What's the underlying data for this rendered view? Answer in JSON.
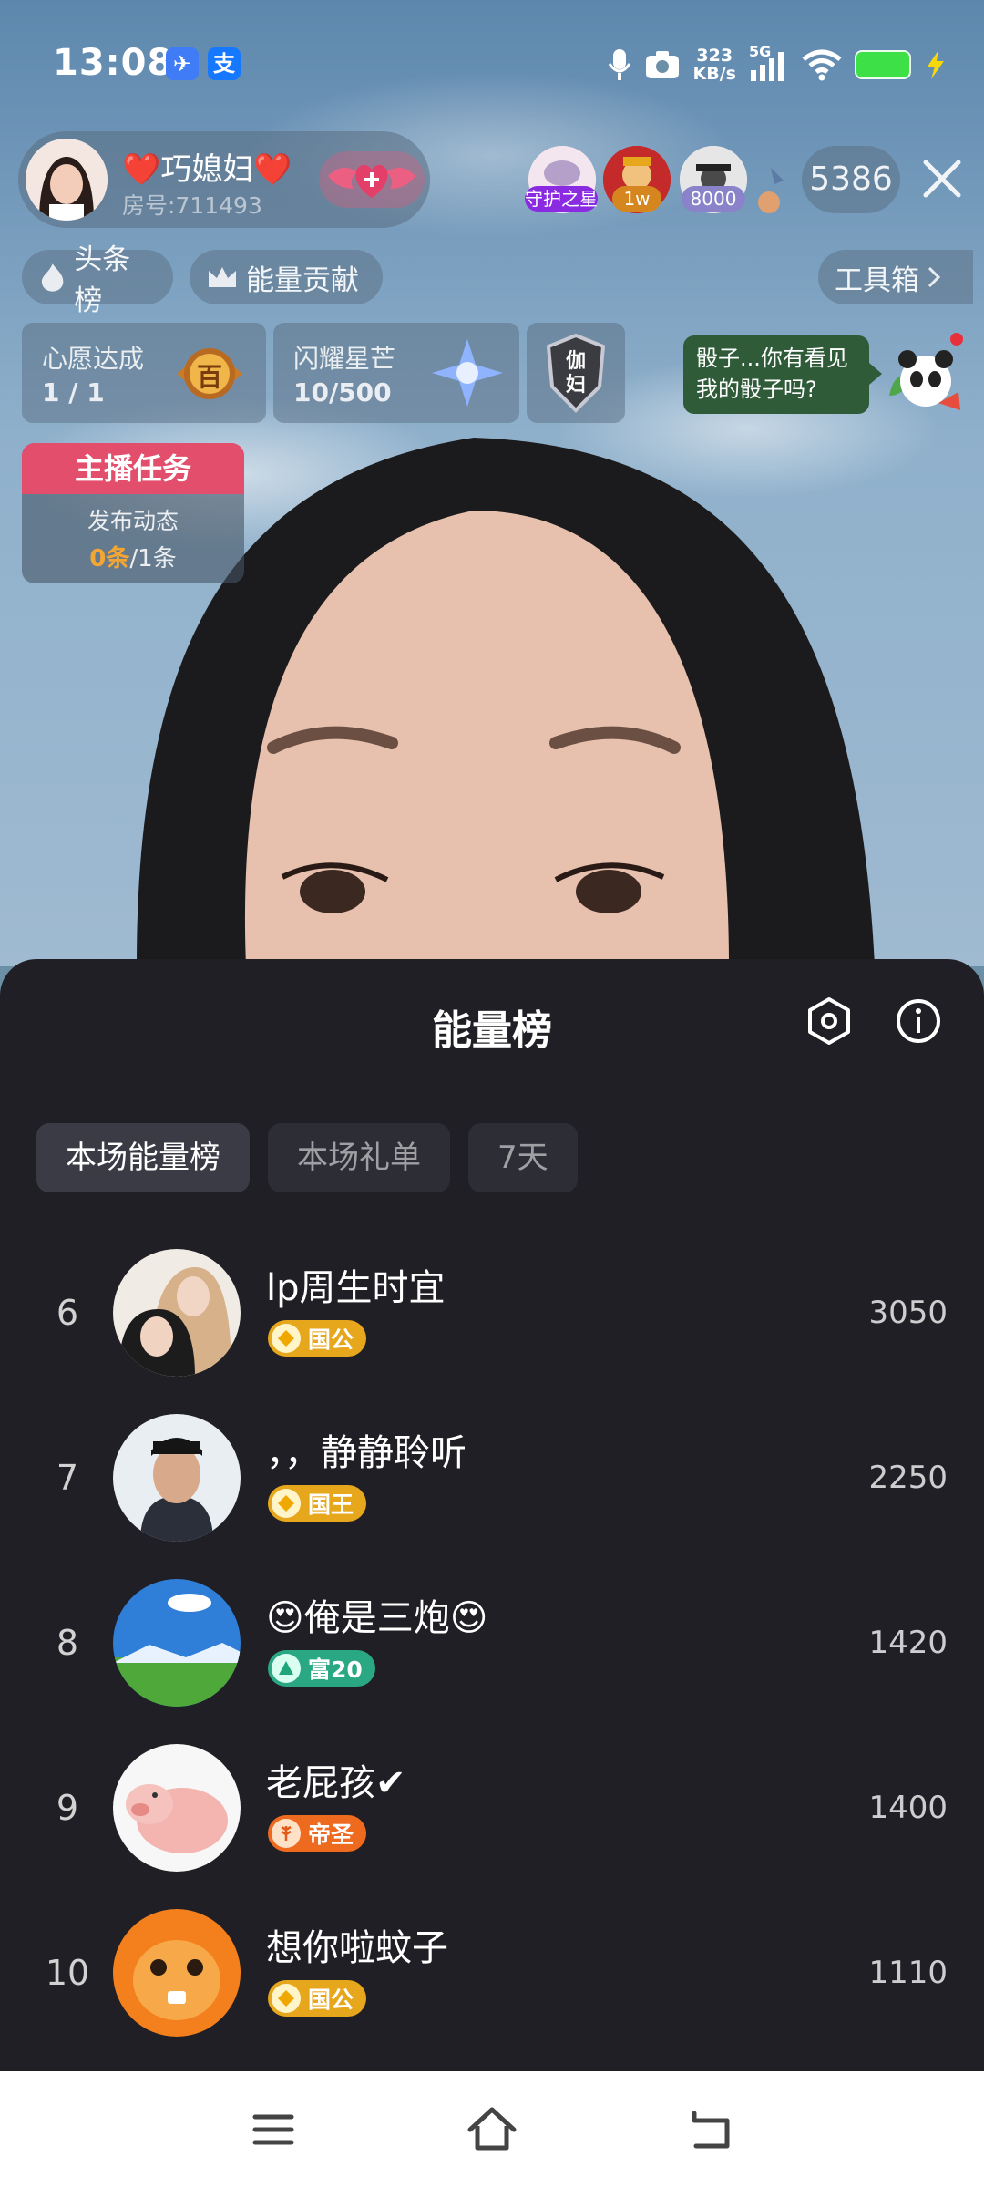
{
  "status_bar": {
    "time": "13:08",
    "app_icon_1": "✈",
    "app_icon_2": "支",
    "speed_top": "323",
    "speed_bottom": "KB/s",
    "network": "5G",
    "battery_color": "#3ee047"
  },
  "host": {
    "name": "❤️巧媳妇❤️",
    "room": "房号:711493"
  },
  "top_viewers": [
    {
      "tag": "守护之星",
      "tag_color": "#8a2be2"
    },
    {
      "tag": "1w",
      "tag_color": "#d6861f"
    },
    {
      "tag": "8000",
      "tag_color": "#8a83c9"
    }
  ],
  "viewer_count": "5386",
  "pills": {
    "headlines": "头条榜",
    "energy_contribution": "能量贡献",
    "toolbox": "工具箱"
  },
  "task_boxes": {
    "wish_title": "心愿达成",
    "wish_value": "1 / 1",
    "wish_medal": "百",
    "star_title": "闪耀星芒",
    "star_value": "10/500",
    "shield_text_1": "伽",
    "shield_text_2": "妇"
  },
  "bubble": {
    "line1": "骰子...你有看见",
    "line2": "我的骰子吗?"
  },
  "anchor_task": {
    "title": "主播任务",
    "subtitle": "发布动态",
    "progress_done": "0条",
    "progress_total": "/1条"
  },
  "sheet": {
    "title": "能量榜",
    "tabs": [
      "本场能量榜",
      "本场礼单",
      "7天"
    ],
    "rows": [
      {
        "rank": "6",
        "name": "lp周生时宜",
        "badge": "国公",
        "score": "3050",
        "badge_color": "#e7a71c"
      },
      {
        "rank": "7",
        "name": "，，静静聆听",
        "badge": "国王",
        "score": "2250",
        "badge_color": "#e7a71c"
      },
      {
        "rank": "8",
        "name": "😍俺是三炮😍",
        "badge": "富20",
        "score": "1420",
        "badge_color": "#2aa884"
      },
      {
        "rank": "9",
        "name": "老屁孩✔",
        "badge": "帝圣",
        "score": "1400",
        "badge_color": "#ee6a1f"
      },
      {
        "rank": "10",
        "name": "想你啦蚊子",
        "badge": "国公",
        "score": "1110",
        "badge_color": "#e7a71c"
      }
    ]
  },
  "icons": {
    "settings": "hexagon-settings-icon",
    "info": "info-icon",
    "close": "close-icon"
  }
}
